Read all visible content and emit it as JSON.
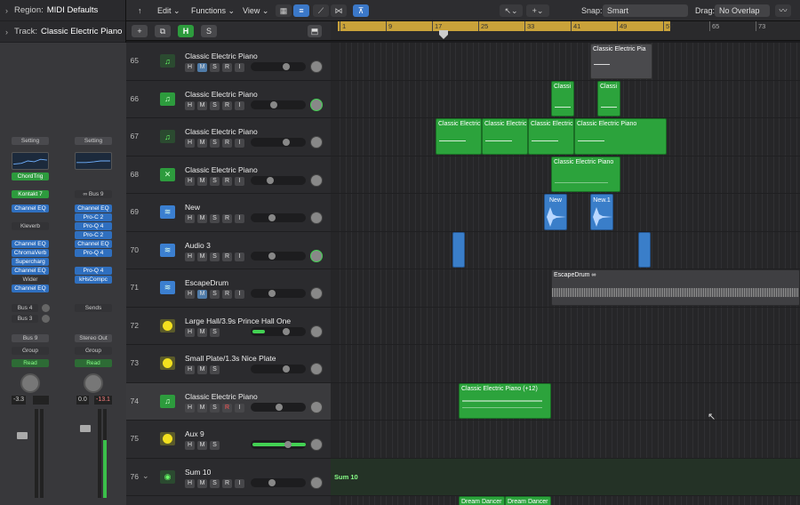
{
  "inspector": {
    "region_label": "Region:",
    "region_value": "MIDI Defaults",
    "track_label": "Track:",
    "track_value": "Classic Electric Piano",
    "strip1": {
      "setting": "Setting",
      "chord": "ChordTrig",
      "instrument": "Kontakt 7",
      "plugins": [
        "Channel EQ"
      ],
      "klev": "Kleverb",
      "plugins2": [
        "Channel EQ",
        "ChromaVerb",
        "Supercharg",
        "Channel EQ",
        "Wider",
        "Channel EQ"
      ],
      "sends": [
        "Bus 4",
        "Bus 3"
      ],
      "output": "Bus 9",
      "group": "Group",
      "auto": "Read",
      "vol": "-3.3"
    },
    "strip2": {
      "setting": "Setting",
      "input": "Bus 9",
      "plugins": [
        "Channel EQ",
        "Pro-C 2",
        "Pro-Q 4",
        "Pro-C 2",
        "Channel EQ",
        "Pro-Q 4",
        "Pro-Q 4",
        "kHsCompc"
      ],
      "sends": "Sends",
      "output": "Stereo Out",
      "group": "Group",
      "auto": "Read",
      "vol": "0.0",
      "peak": "-13.1"
    }
  },
  "toolbar": {
    "back_icon": "up-arrow-icon",
    "edit": "Edit",
    "functions": "Functions",
    "view": "View",
    "snap_label": "Snap:",
    "snap_value": "Smart",
    "drag_label": "Drag:",
    "drag_value": "No Overlap",
    "h_label": "H",
    "s_label": "S",
    "add_label": "+"
  },
  "ruler": {
    "bars": [
      "1",
      "9",
      "17",
      "25",
      "33",
      "41",
      "49",
      "57",
      "65",
      "73"
    ]
  },
  "tracks": [
    {
      "num": "65",
      "name": "Classic Electric Piano",
      "icon": "music-note-icon"
    },
    {
      "num": "66",
      "name": "Classic Electric Piano",
      "icon": "music-note-icon"
    },
    {
      "num": "67",
      "name": "Classic Electric Piano",
      "icon": "music-note-icon"
    },
    {
      "num": "68",
      "name": "Classic Electric Piano",
      "icon": "tools-icon"
    },
    {
      "num": "69",
      "name": "New",
      "icon": "waveform-icon"
    },
    {
      "num": "70",
      "name": "Audio 3",
      "icon": "waveform-icon"
    },
    {
      "num": "71",
      "name": "EscapeDrum",
      "icon": "waveform-icon"
    },
    {
      "num": "72",
      "name": "Large Hall/3.9s Prince Hall One",
      "icon": "aux-icon"
    },
    {
      "num": "73",
      "name": "Small Plate/1.3s Nice Plate",
      "icon": "aux-icon"
    },
    {
      "num": "74",
      "name": "Classic Electric Piano",
      "icon": "music-note-icon"
    },
    {
      "num": "75",
      "name": "Aux 9",
      "icon": "aux-icon"
    },
    {
      "num": "76",
      "name": "Sum 10",
      "icon": "sum-icon"
    }
  ],
  "track_buttons": {
    "h": "H",
    "m": "M",
    "s": "S",
    "r": "R",
    "i": "I"
  },
  "regions": {
    "r65": "Classic Electric Pia",
    "r66a": "Classi",
    "r66b": "Classi",
    "r67a": "Classic Electric",
    "r67b": "Classic Electric",
    "r67c": "Classic Electric",
    "r67d": "Classic Electric Piano",
    "r68": "Classic Electric Piano",
    "r69a": "New",
    "r69b": "New.1",
    "r71": "EscapeDrum",
    "r74": "Classic Electric Piano (+12)",
    "sum": "Sum 10",
    "dd1": "Dream Dancer",
    "dd2": "Dream Dancer"
  }
}
